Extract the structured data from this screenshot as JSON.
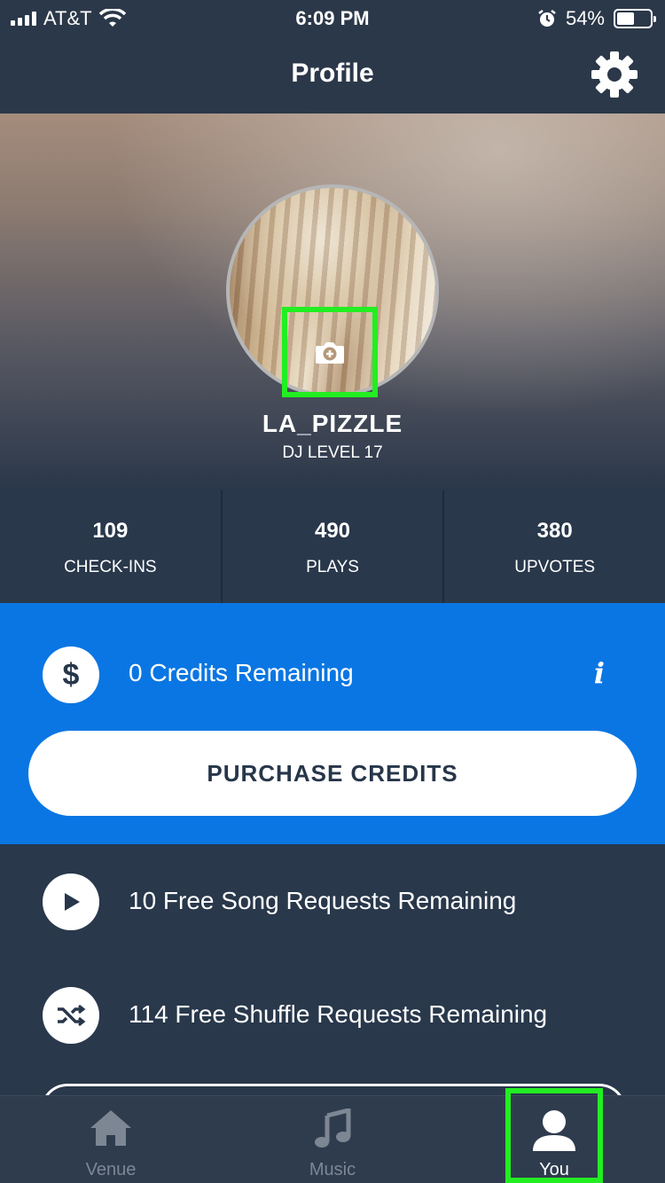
{
  "status_bar": {
    "carrier": "AT&T",
    "time": "6:09 PM",
    "battery_percent": "54%",
    "battery_level": 0.54
  },
  "nav": {
    "title": "Profile",
    "settings_icon": "gear-icon"
  },
  "profile": {
    "username": "LA_PIZZLE",
    "level": "DJ LEVEL 17",
    "camera_icon": "camera-plus-icon"
  },
  "stats": [
    {
      "value": "109",
      "label": "CHECK-INS"
    },
    {
      "value": "490",
      "label": "PLAYS"
    },
    {
      "value": "380",
      "label": "UPVOTES"
    }
  ],
  "credits": {
    "icon_glyph": "$",
    "text": "0 Credits Remaining",
    "info_glyph": "i",
    "purchase_label": "PURCHASE CREDITS"
  },
  "free": [
    {
      "icon": "play-icon",
      "text": "10 Free Song Requests Remaining"
    },
    {
      "icon": "shuffle-icon",
      "text": "114 Free Shuffle Requests Remaining"
    }
  ],
  "tabs": [
    {
      "icon": "home-icon",
      "label": "Venue"
    },
    {
      "icon": "music-note-icon",
      "label": "Music"
    },
    {
      "icon": "person-icon",
      "label": "You"
    }
  ],
  "colors": {
    "accent_blue": "#0a76e3",
    "background": "#29384b",
    "highlight_green": "#22ee22"
  }
}
